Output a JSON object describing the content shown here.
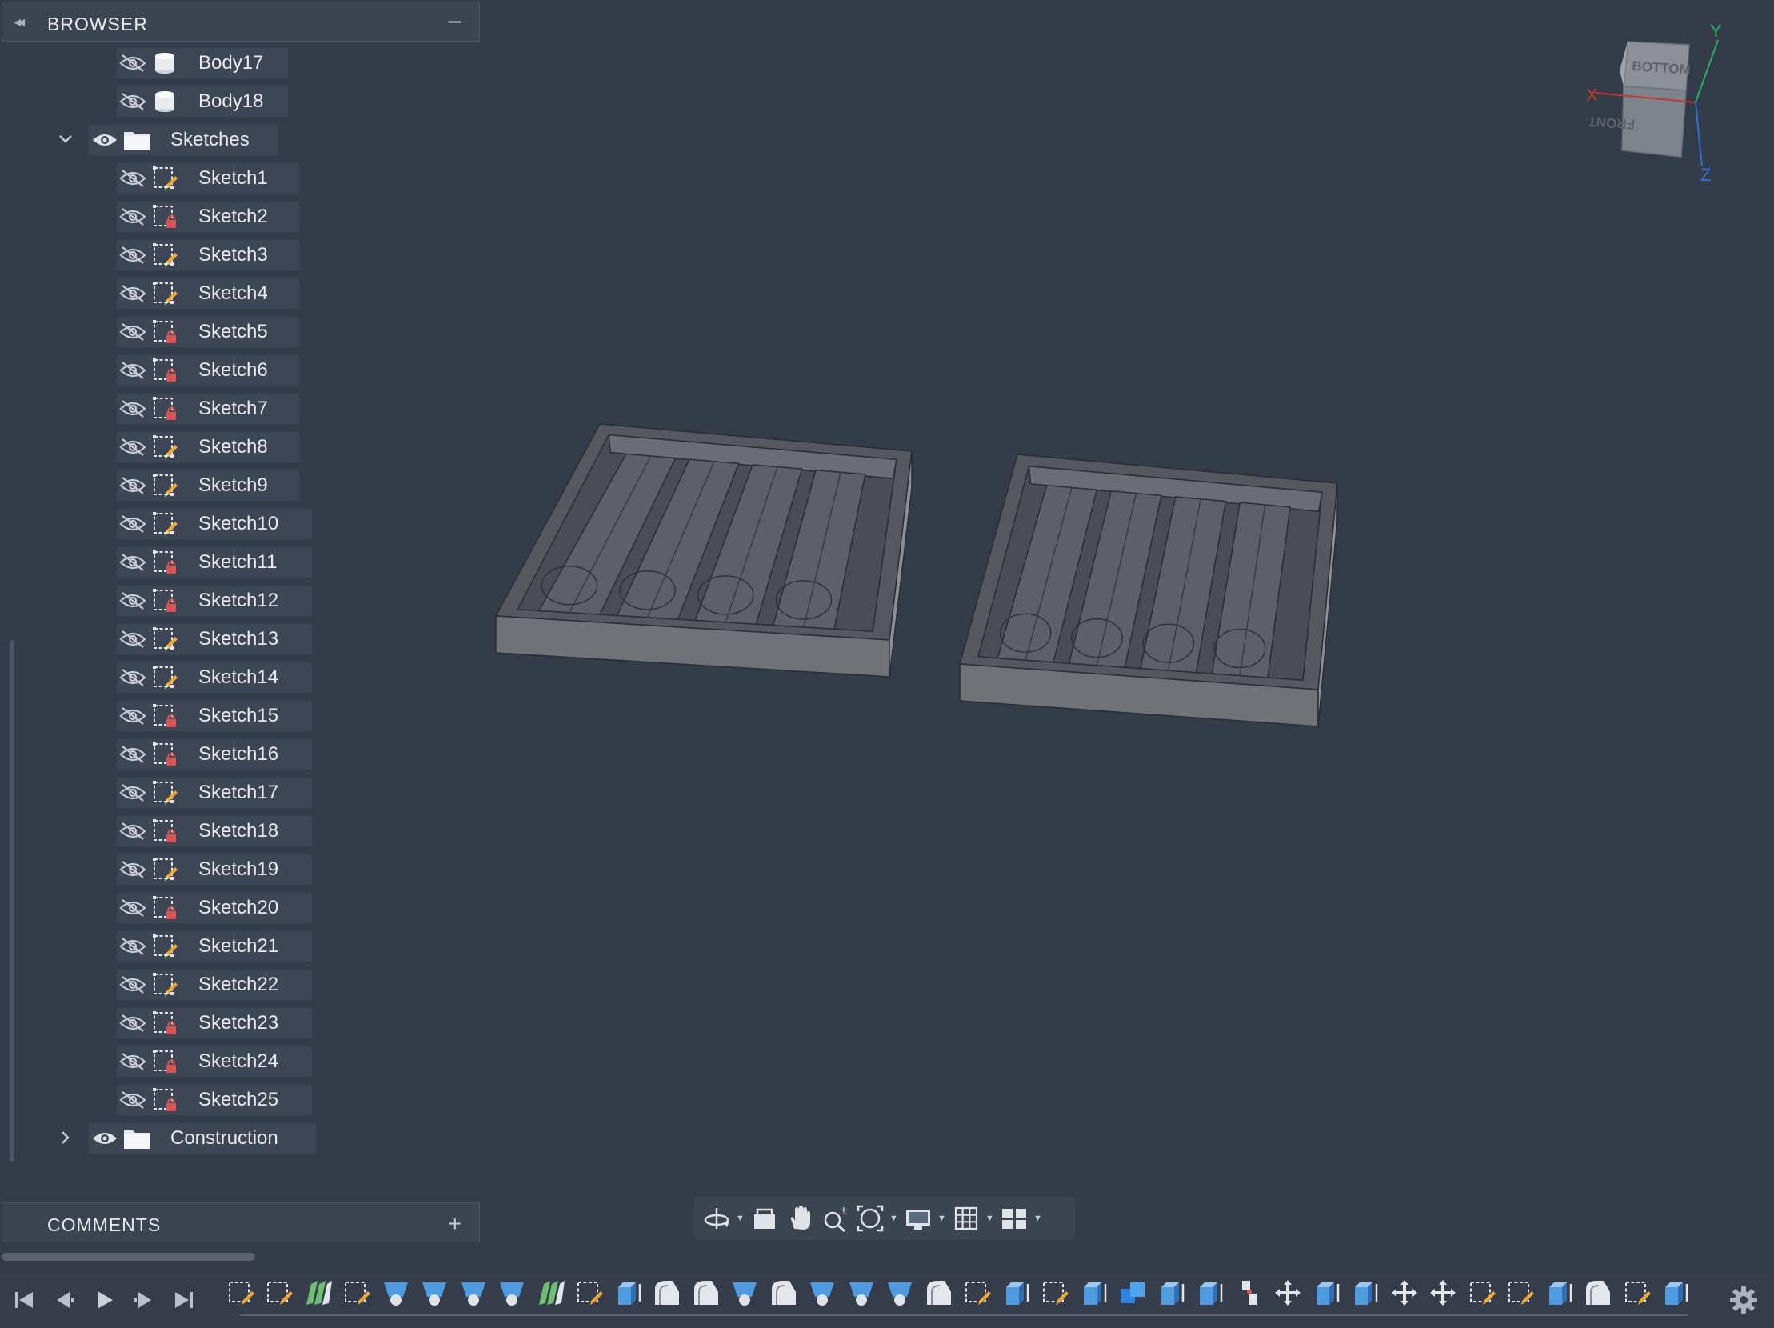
{
  "browser": {
    "title": "BROWSER",
    "collapse_glyph": "◂◂",
    "minimize_glyph": "–",
    "bodies": [
      {
        "label": "Body17",
        "visibility_icon": "eye-hidden-icon",
        "type_icon": "body-icon"
      },
      {
        "label": "Body18",
        "visibility_icon": "eye-hidden-icon",
        "type_icon": "body-icon"
      }
    ],
    "sketches_folder": {
      "label": "Sketches",
      "chevron": "⌄"
    },
    "sketches": [
      {
        "label": "Sketch1",
        "kind": "pencil"
      },
      {
        "label": "Sketch2",
        "kind": "lock"
      },
      {
        "label": "Sketch3",
        "kind": "pencil"
      },
      {
        "label": "Sketch4",
        "kind": "pencil"
      },
      {
        "label": "Sketch5",
        "kind": "lock"
      },
      {
        "label": "Sketch6",
        "kind": "lock"
      },
      {
        "label": "Sketch7",
        "kind": "lock"
      },
      {
        "label": "Sketch8",
        "kind": "pencil"
      },
      {
        "label": "Sketch9",
        "kind": "pencil"
      },
      {
        "label": "Sketch10",
        "kind": "pencil"
      },
      {
        "label": "Sketch11",
        "kind": "lock"
      },
      {
        "label": "Sketch12",
        "kind": "lock"
      },
      {
        "label": "Sketch13",
        "kind": "pencil"
      },
      {
        "label": "Sketch14",
        "kind": "pencil"
      },
      {
        "label": "Sketch15",
        "kind": "lock"
      },
      {
        "label": "Sketch16",
        "kind": "lock"
      },
      {
        "label": "Sketch17",
        "kind": "pencil"
      },
      {
        "label": "Sketch18",
        "kind": "lock"
      },
      {
        "label": "Sketch19",
        "kind": "pencil"
      },
      {
        "label": "Sketch20",
        "kind": "lock"
      },
      {
        "label": "Sketch21",
        "kind": "pencil"
      },
      {
        "label": "Sketch22",
        "kind": "pencil"
      },
      {
        "label": "Sketch23",
        "kind": "lock"
      },
      {
        "label": "Sketch24",
        "kind": "lock"
      },
      {
        "label": "Sketch25",
        "kind": "lock"
      }
    ],
    "construction_folder": {
      "label": "Construction",
      "chevron": "›"
    }
  },
  "comments": {
    "title": "COMMENTS",
    "add_glyph": "+"
  },
  "viewcube": {
    "top_face": "BOTTOM",
    "front_face": "FRONT",
    "axis_x": "X",
    "axis_y": "Y",
    "axis_z": "Z"
  },
  "viewport_toolbar": [
    "orbit-icon",
    "look-at-icon",
    "pan-hand-icon",
    "zoom-icon",
    "fit-icon",
    "display-settings-icon",
    "grid-icon",
    "viewports-icon"
  ],
  "timeline": {
    "controls": [
      "skip-start-icon",
      "step-back-icon",
      "play-icon",
      "step-forward-icon",
      "skip-end-icon"
    ],
    "features": [
      "sketch",
      "sketch",
      "surface",
      "sketch",
      "extrude",
      "extrude",
      "extrude",
      "extrude",
      "surface",
      "sketch",
      "box",
      "fillet",
      "fillet",
      "extrude",
      "fillet",
      "extrude",
      "extrude",
      "extrude",
      "fillet",
      "sketch",
      "box",
      "sketch",
      "box",
      "combine",
      "box",
      "box",
      "joint",
      "move",
      "box",
      "box",
      "move",
      "move",
      "sketch",
      "sketch",
      "box",
      "fillet",
      "sketch",
      "box"
    ]
  },
  "colors": {
    "background": "#333c49",
    "panel": "#3b4451",
    "row": "#3d4654",
    "lock_badge": "#d9534f",
    "pencil_badge": "#f0a830",
    "axis_x": "#c0392b",
    "axis_y": "#27ae60",
    "axis_z": "#2e6fd8"
  }
}
